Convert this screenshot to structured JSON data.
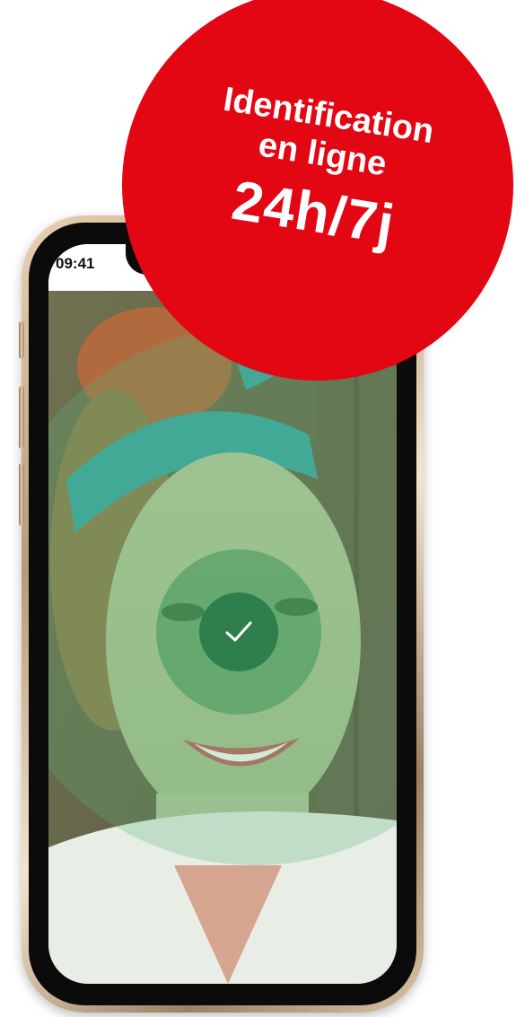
{
  "status_bar": {
    "time": "09:41"
  },
  "promo": {
    "line1": "Identification",
    "line2": "en ligne",
    "line3": "24h/7j",
    "color": "#e30613"
  },
  "verification": {
    "icon": "check-icon",
    "state_color": "#2f7f4c"
  }
}
